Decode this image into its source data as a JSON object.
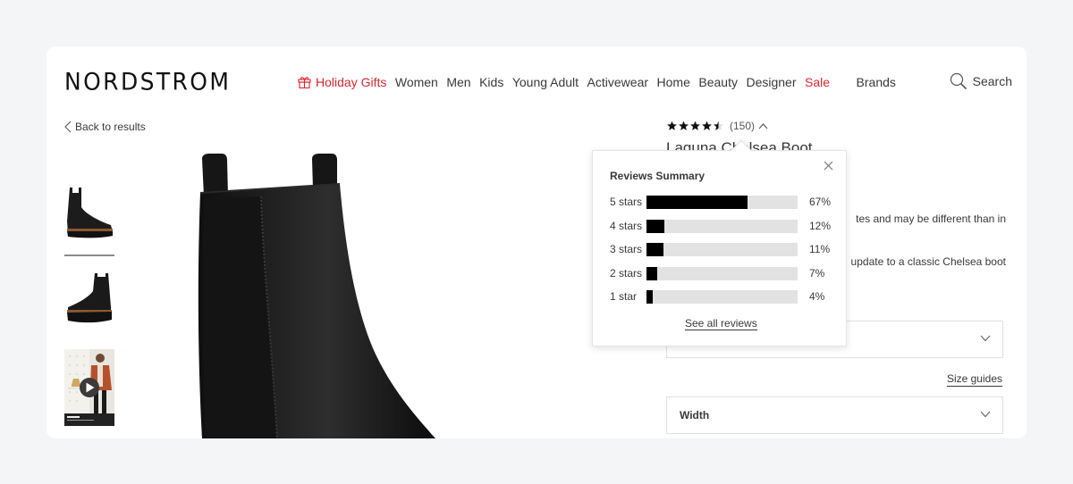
{
  "brand": {
    "logo_text": "NORDSTROM"
  },
  "nav": {
    "holiday_gifts": "Holiday Gifts",
    "items": [
      "Women",
      "Men",
      "Kids",
      "Young Adult",
      "Activewear",
      "Home",
      "Beauty",
      "Designer"
    ],
    "sale": "Sale",
    "brands": "Brands",
    "search": "Search"
  },
  "colors": {
    "accent_red": "#d6282f",
    "text": "#393939",
    "bar_fill": "#000000",
    "bar_track": "#e2e2e2",
    "page_bg": "#f4f5f7"
  },
  "back_link": "Back to results",
  "thumbnails": [
    {
      "label": "Boot side view",
      "selected": true
    },
    {
      "label": "Boot angled view",
      "selected": false
    },
    {
      "label": "Video: model with boot",
      "type": "video"
    }
  ],
  "product": {
    "rating": 4.5,
    "rating_max": 5,
    "review_count": "(150)",
    "title": "Laguna Chelsea Boot",
    "desc_line1": "tes and may be different than in",
    "desc_line2": "update to a classic Chelsea boot",
    "size_guides": "Size guides",
    "width_label": "Width",
    "size_label": ""
  },
  "reviews_summary": {
    "title": "Reviews Summary",
    "rows": [
      {
        "label": "5 stars",
        "percent": 67,
        "percent_text": "67%"
      },
      {
        "label": "4 stars",
        "percent": 12,
        "percent_text": "12%"
      },
      {
        "label": "3 stars",
        "percent": 11,
        "percent_text": "11%"
      },
      {
        "label": "2 stars",
        "percent": 7,
        "percent_text": "7%"
      },
      {
        "label": "1 star",
        "percent": 4,
        "percent_text": "4%"
      }
    ],
    "see_all": "See all reviews"
  }
}
